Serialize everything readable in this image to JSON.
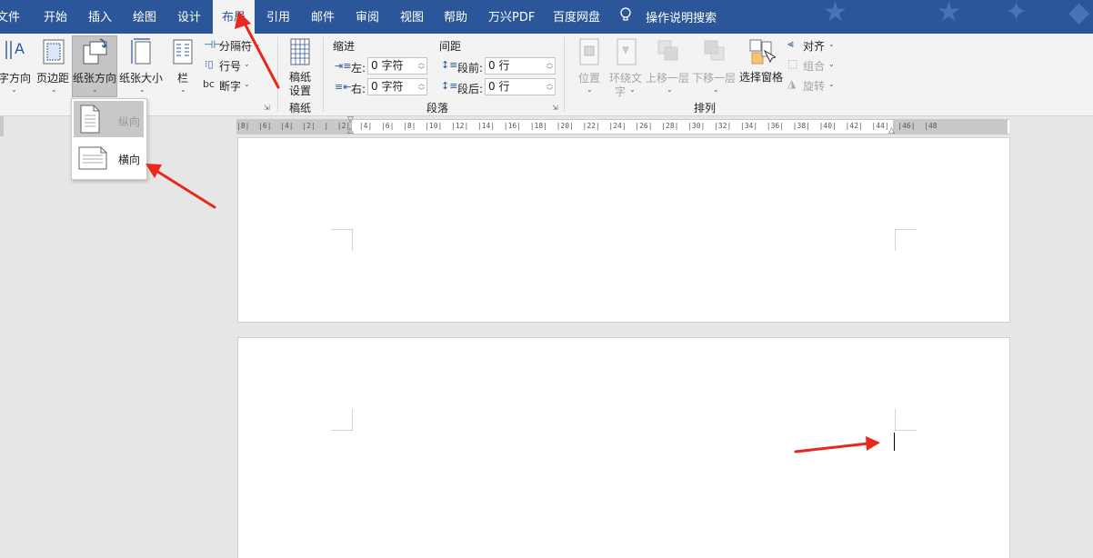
{
  "tabs": [
    {
      "label": "文件"
    },
    {
      "label": "开始"
    },
    {
      "label": "插入"
    },
    {
      "label": "绘图"
    },
    {
      "label": "设计"
    },
    {
      "label": "布局",
      "active": true
    },
    {
      "label": "引用"
    },
    {
      "label": "邮件"
    },
    {
      "label": "审阅"
    },
    {
      "label": "视图"
    },
    {
      "label": "帮助"
    },
    {
      "label": "万兴PDF"
    },
    {
      "label": "百度网盘"
    },
    {
      "label": "操作说明搜索"
    }
  ],
  "page_setup": {
    "text_direction": "字方向",
    "margins": "页边距",
    "orientation": "纸张方向",
    "size": "纸张大小",
    "columns": "栏",
    "breaks": "分隔符",
    "line_numbers": "行号",
    "hyphenation": "断字"
  },
  "manuscript": {
    "button": "稿纸\n设置",
    "line1": "稿纸",
    "line2": "设置",
    "group": "稿纸"
  },
  "paragraph": {
    "indent_header": "缩进",
    "spacing_header": "间距",
    "left_label": "左:",
    "left_value": "0 字符",
    "right_label": "右:",
    "right_value": "0 字符",
    "before_label": "段前:",
    "before_value": "0 行",
    "after_label": "段后:",
    "after_value": "0 行",
    "group": "段落"
  },
  "arrange": {
    "position": "位置",
    "wrap_line1": "环绕文",
    "wrap_line2": "字",
    "bring_forward": "上移一层",
    "send_backward": "下移一层",
    "selection_pane": "选择窗格",
    "align": "对齐",
    "group_btn": "组合",
    "rotate": "旋转",
    "group": "排列"
  },
  "orientation_menu": {
    "portrait": "纵向",
    "landscape": "横向"
  },
  "ruler_text": "|8|  |6|  |4|  |2|  |  |2|  |4|  |6|  |8|  |10|  |12|  |14|  |16|  |18|  |20|  |22|  |24|  |26|  |28|  |30|  |32|  |34|  |36|  |38|  |40|  |42|  |44|  |46|  |48",
  "colors": {
    "tab_bar": "#2b579a",
    "ribbon": "#f3f3f3",
    "arrow": "#e8271f"
  }
}
